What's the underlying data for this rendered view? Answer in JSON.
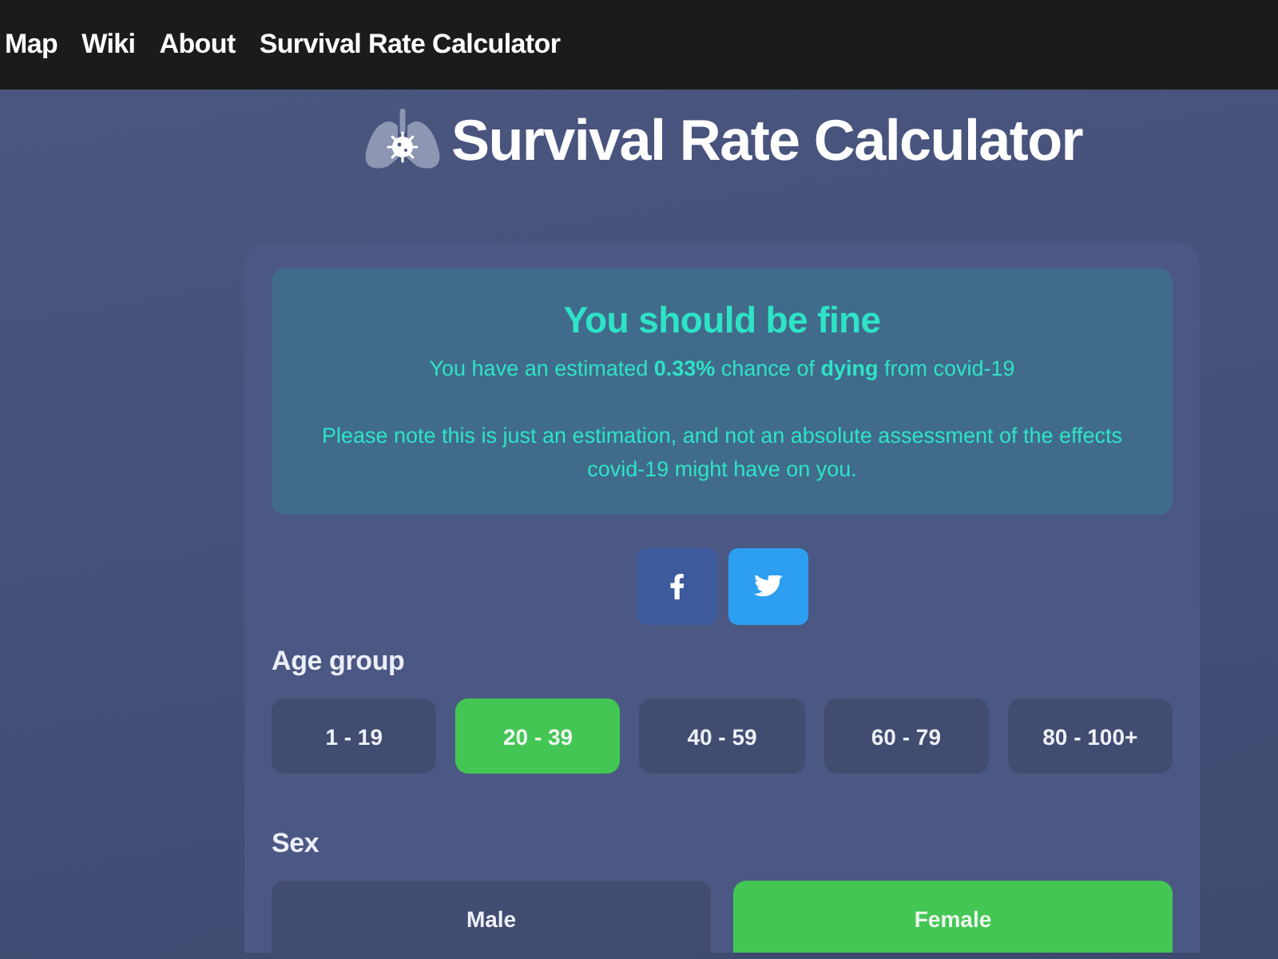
{
  "nav": {
    "links": [
      {
        "label": "Map"
      },
      {
        "label": "Wiki"
      },
      {
        "label": "About"
      },
      {
        "label": "Survival Rate Calculator"
      }
    ]
  },
  "header": {
    "title": "Survival Rate Calculator"
  },
  "result": {
    "heading": "You should be fine",
    "estimate": "You have an estimated **0.33%** chance of **dying** from covid-19",
    "note": "Please note this is just an estimation, and not an absolute assessment of the effects covid-19 might have on you."
  },
  "share": [
    {
      "kind": "facebook"
    },
    {
      "kind": "twitter"
    }
  ],
  "age_group": {
    "label": "Age group",
    "options": [
      {
        "label": "1 - 19",
        "selected": false
      },
      {
        "label": "20 - 39",
        "selected": true
      },
      {
        "label": "40 - 59",
        "selected": false
      },
      {
        "label": "60 - 79",
        "selected": false
      },
      {
        "label": "80 - 100+",
        "selected": false
      }
    ]
  },
  "sex": {
    "label": "Sex",
    "options": [
      {
        "label": "Male",
        "selected": false
      },
      {
        "label": "Female",
        "selected": true
      }
    ]
  }
}
